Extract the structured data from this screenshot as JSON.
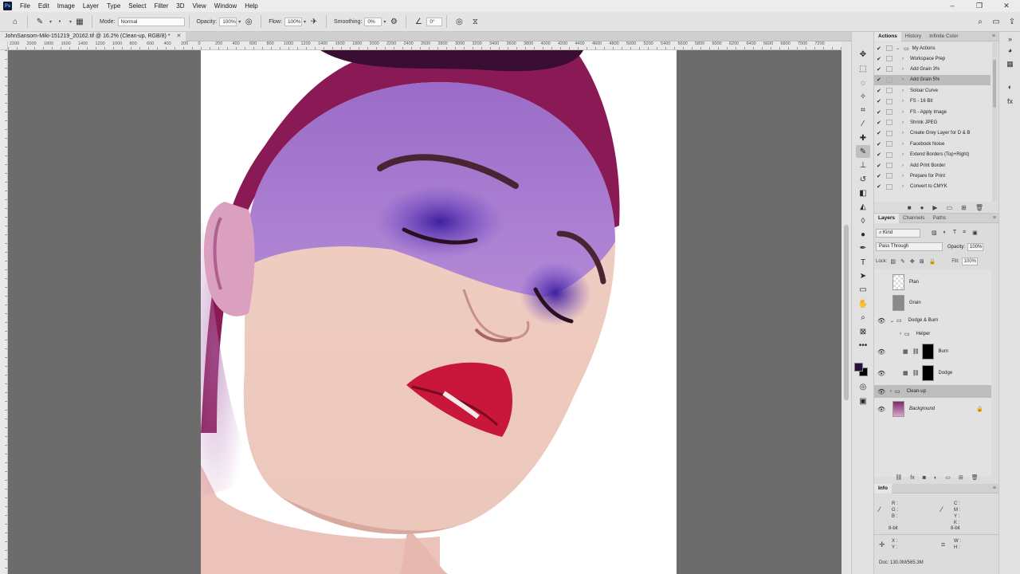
{
  "app": {
    "logo": "Ps",
    "menu": [
      "File",
      "Edit",
      "Image",
      "Layer",
      "Type",
      "Select",
      "Filter",
      "3D",
      "View",
      "Window",
      "Help"
    ],
    "window_controls": [
      "–",
      "❐",
      "✕"
    ]
  },
  "options_bar": {
    "mode_label": "Mode:",
    "mode_value": "Normal",
    "opacity_label": "Opacity:",
    "opacity_value": "100%",
    "flow_label": "Flow:",
    "flow_value": "100%",
    "smoothing_label": "Smoothing:",
    "smoothing_value": "0%",
    "angle_value": "0°"
  },
  "document": {
    "tab_title": "JohnSansom-Miki-151219_20162.tif @ 16.2% (Clean-up, RGB/8) *",
    "ruler_labels": [
      "2200",
      "2000",
      "1800",
      "1600",
      "1400",
      "1200",
      "1000",
      "800",
      "600",
      "400",
      "200",
      "0",
      "200",
      "400",
      "600",
      "800",
      "1000",
      "1200",
      "1400",
      "1600",
      "1800",
      "2000",
      "2200",
      "2400",
      "2600",
      "2800",
      "3000",
      "3200",
      "3400",
      "3600",
      "3800",
      "4000",
      "4200",
      "4400",
      "4600",
      "4800",
      "5000",
      "5200",
      "5400",
      "5600",
      "5800",
      "6000",
      "6200",
      "6400",
      "6600",
      "6800",
      "7000",
      "7200"
    ]
  },
  "actions_panel": {
    "tabs": [
      "Actions",
      "History",
      "Infinite Color"
    ],
    "set_name": "My Actions",
    "items": [
      "Workspace Prep",
      "Add Grain 3%",
      "Add Grain 5%",
      "Soloar Curve",
      "FS - 16 Bit",
      "FS - Apply Image",
      "Shrink JPEG",
      "Create Grey Layer for D & B",
      "Facebook Noise",
      "Extend Borders (Top+Right)",
      "Add Print Border",
      "Prepare for Print",
      "Convert to CMYK"
    ],
    "selected_item": "Add Grain 5%"
  },
  "layers_panel": {
    "tabs": [
      "Layers",
      "Channels",
      "Paths"
    ],
    "kind_filter": "Kind",
    "blend_mode": "Pass Through",
    "opacity_label": "Opacity:",
    "opacity_value": "100%",
    "lock_label": "Lock:",
    "fill_label": "Fill:",
    "fill_value": "100%",
    "layers": [
      {
        "name": "Plan",
        "visible": false
      },
      {
        "name": "Grain",
        "visible": false
      },
      {
        "name": "Dodge & Burn",
        "visible": true
      },
      {
        "name": "Helper",
        "visible": false
      },
      {
        "name": "Burn",
        "visible": true
      },
      {
        "name": "Dodge",
        "visible": true
      },
      {
        "name": "Clean-up",
        "visible": true
      },
      {
        "name": "Background",
        "visible": true
      }
    ],
    "selected_layer": "Clean-up"
  },
  "info_panel": {
    "title": "Info",
    "rgb_labels": [
      "R :",
      "G :",
      "B :"
    ],
    "cmyk_labels": [
      "C :",
      "M :",
      "Y :",
      "K :"
    ],
    "bit_left": "8-bit",
    "bit_right": "8-bit",
    "xy_labels": [
      "X :",
      "Y :"
    ],
    "wh_labels": [
      "W :",
      "H :"
    ],
    "doc_status": "Doc: 130.0M/565.3M"
  },
  "colors": {
    "foreground": "#2a0f3d",
    "background": "#000000",
    "canvas_gray": "#6c6c6c"
  }
}
